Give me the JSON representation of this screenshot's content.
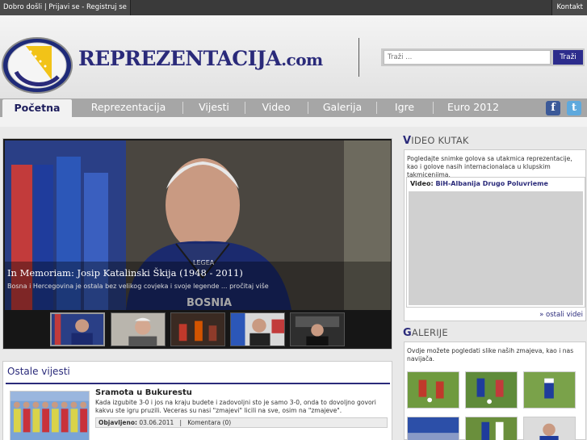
{
  "topbar": {
    "welcome": "Dobro došli",
    "login": "Prijavi se",
    "register": "Registruj se",
    "contact": "Kontakt"
  },
  "header": {
    "logo_main": "REPREZENTACIJA",
    "logo_suffix": ".com",
    "ball_text": "reprezentacija.com"
  },
  "search": {
    "placeholder": "Traži ...",
    "button": "Traži"
  },
  "nav": {
    "items": [
      "Početna",
      "Reprezentacija",
      "Vijesti",
      "Video",
      "Galerija",
      "Igre",
      "Euro 2012"
    ],
    "active": "Početna"
  },
  "social": {
    "facebook": "f",
    "twitter": "t"
  },
  "slider": {
    "title": "In Memoriam: Josip Katalinski Škija (1948 - 2011)",
    "description": "Bosna i Hercegovina je ostala bez velikog covjeka i svoje legende ... pročitaj više",
    "shirt_brand": "LEGEA",
    "shirt_text": "BOSNIA",
    "thumb_count": 5
  },
  "news": {
    "heading": "Ostale vijesti",
    "items": [
      {
        "title": "Sramota u Bukurestu",
        "text": "Kada izgubite 3-0 i jos na kraju budete i zadovoljni sto je samo 3-0, onda to dovoljno govori kakvu ste igru pruzili. Veceras su nasi \"zmajevi\" licili na sve, osim na \"zmajeve\".",
        "published_label": "Objavljeno:",
        "published_date": "03.06.2011",
        "comments": "Komentara (0)"
      }
    ]
  },
  "video_corner": {
    "heading_first": "V",
    "heading_rest": "IDEO KUTAK",
    "intro": "Pogledajte snimke golova sa utakmica reprezentacije, kao i golove nasih internacionalaca u klupskim takmicenjima.",
    "label": "Video:",
    "video_title": "BiH-Albanija Drugo Poluvrieme",
    "more_link": "» ostali videi"
  },
  "gallery": {
    "heading_first": "G",
    "heading_rest": "ALERIJE",
    "intro": "Ovdje možete pogledati slike naših zmajeva, kao i nas navijača."
  },
  "colors": {
    "brand_blue": "#2a2a7a",
    "nav_gray": "#a6a6a6",
    "topbar": "#3a3a3a"
  }
}
